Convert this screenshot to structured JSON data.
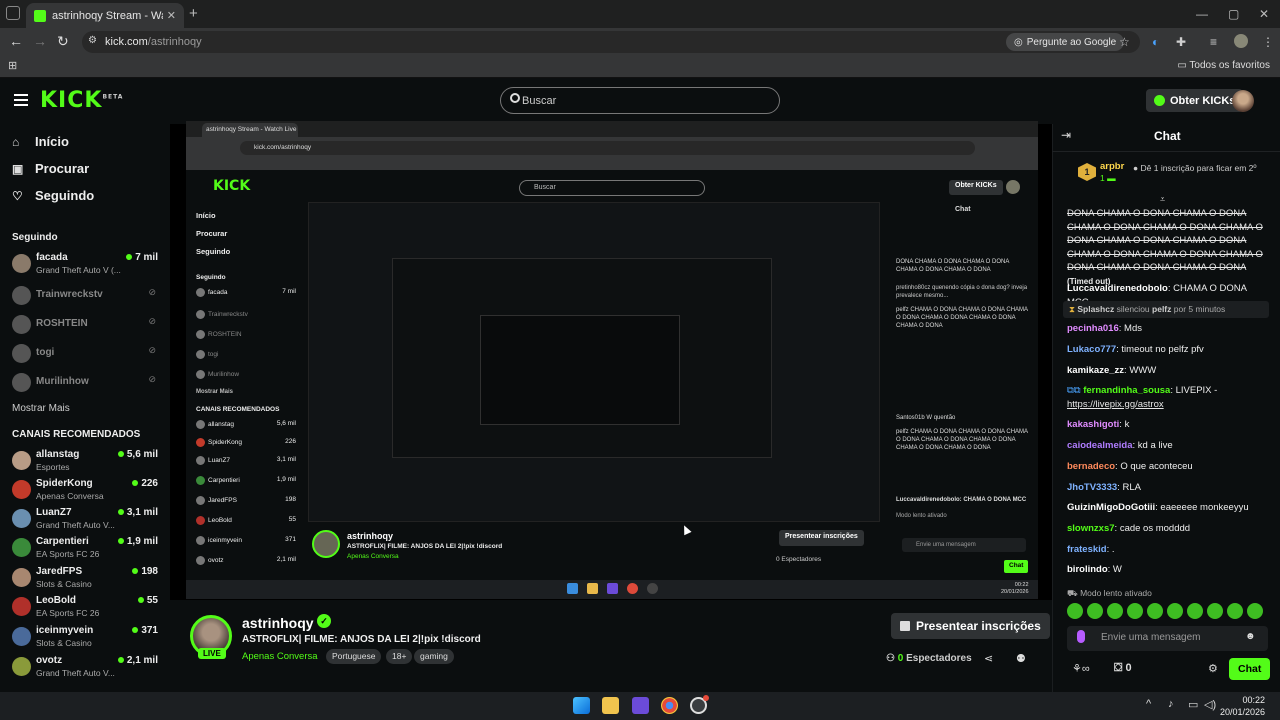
{
  "browser": {
    "tab_title": "astrinhoqy Stream - Watch Live",
    "tab_close": "✕",
    "new_tab": "+",
    "url_domain": "kick.com",
    "url_path": "/astrinhoqy",
    "ask_google": "Pergunte ao Google",
    "bookmarks_folder": "Todos os favoritos"
  },
  "header": {
    "logo": "KICK",
    "logo_sup": "BETA",
    "search_placeholder": "Buscar",
    "get_kicks": "Obter KICKs"
  },
  "sidebar": {
    "nav": [
      {
        "label": "Início",
        "icon": "home-icon"
      },
      {
        "label": "Procurar",
        "icon": "browse-icon"
      },
      {
        "label": "Seguindo",
        "icon": "heart-icon"
      }
    ],
    "following_title": "Seguindo",
    "following": [
      {
        "name": "facada",
        "game": "Grand Theft Auto V (...",
        "viewers": "7 mil",
        "online": true
      },
      {
        "name": "Trainwreckstv",
        "online": false
      },
      {
        "name": "ROSHTEIN",
        "online": false
      },
      {
        "name": "togi",
        "online": false
      },
      {
        "name": "Murilinhow",
        "online": false
      }
    ],
    "show_more": "Mostrar Mais",
    "recommended_title": "CANAIS RECOMENDADOS",
    "recommended": [
      {
        "name": "allanstag",
        "game": "Esportes",
        "viewers": "5,6 mil"
      },
      {
        "name": "SpiderKong",
        "game": "Apenas Conversa",
        "viewers": "226"
      },
      {
        "name": "LuanZ7",
        "game": "Grand Theft Auto V...",
        "viewers": "3,1 mil"
      },
      {
        "name": "Carpentieri",
        "game": "EA Sports FC 26",
        "viewers": "1,9 mil"
      },
      {
        "name": "JaredFPS",
        "game": "Slots & Casino",
        "viewers": "198"
      },
      {
        "name": "LeoBold",
        "game": "EA Sports FC 26",
        "viewers": "55"
      },
      {
        "name": "iceinmyvein",
        "game": "Slots & Casino",
        "viewers": "371"
      },
      {
        "name": "ovotz",
        "game": "Grand Theft Auto V...",
        "viewers": "2,1 mil"
      }
    ]
  },
  "stream": {
    "name": "astrinhoqy",
    "live": "LIVE",
    "title": "ASTROFLIX| FILME: ANJOS DA LEI 2|!pix !discord",
    "category": "Apenas Conversa",
    "tags": [
      "Portuguese",
      "18+",
      "gaming"
    ],
    "subscribe": "Presentear inscrições",
    "viewers_count": "0",
    "viewers_label": "Espectadores"
  },
  "chat": {
    "title": "Chat",
    "pinned": {
      "rank": "1",
      "user": "arpbr",
      "subs": "1",
      "text": "Dê 1 inscrição para ficar em 2º"
    },
    "strike_text": "DONA CHAMA O DONA CHAMA O DONA CHAMA O DONA CHAMA O DONA CHAMA O DONA CHAMA O DONA CHAMA O DONA CHAMA O DONA CHAMA O DONA CHAMA O DONA CHAMA O DONA CHAMA O DONA",
    "timed_out": "(Timed out)",
    "silenced": {
      "mod": "Splashcz",
      "text1": "silenciou",
      "user": "pelfz",
      "text2": "por 5 minutos"
    },
    "messages": [
      {
        "user": "Luccavaldirenedobolo",
        "color": "#ffffff",
        "text": "CHAMA O DONA MCC"
      },
      {
        "user": "pecinha016",
        "color": "#e08cff",
        "text": "Mds"
      },
      {
        "user": "Lukaco777",
        "color": "#7fb2ff",
        "text": "timeout no pelfz pfv"
      },
      {
        "user": "kamikaze_zz",
        "color": "#ffffff",
        "text": "WWW"
      },
      {
        "user": "fernandinha_sousa",
        "color": "#53fc18",
        "text": "LIVEPIX -",
        "link": "https://livepix.gg/astrox"
      },
      {
        "user": "kakashigoti",
        "color": "#e08cff",
        "text": "k"
      },
      {
        "user": "caiodealmeida",
        "color": "#b07dff",
        "text": "kd a live"
      },
      {
        "user": "bernadeco",
        "color": "#ff8a5c",
        "text": "O que aconteceu"
      },
      {
        "user": "JhoTV3333",
        "color": "#7fb2ff",
        "text": "RLA"
      },
      {
        "user": "GuizinMigoDoGotiii",
        "color": "#ffffff",
        "text": "eaeeeee monkeeyyu"
      },
      {
        "user": "slownzxs7",
        "color": "#53fc18",
        "text": "cade os modddd"
      },
      {
        "user": "frateskid",
        "color": "#7fb2ff",
        "text": "."
      },
      {
        "user": "birolindo",
        "color": "#ffffff",
        "text": "W"
      }
    ],
    "slow_mode": "Modo lento ativado",
    "input_placeholder": "Envie uma mensagem",
    "count": "0",
    "send": "Chat"
  },
  "inner_capture": {
    "tab_title": "astrinhoqy Stream - Watch Live",
    "url": "kick.com/astrinhoqy",
    "search": "Buscar",
    "get_kicks": "Obter KICKs",
    "nav": [
      "Início",
      "Procurar",
      "Seguindo"
    ],
    "following_title": "Seguindo",
    "show_more": "Mostrar Mais",
    "recommended_title": "CANAIS RECOMENDADOS",
    "channels": [
      {
        "name": "facada",
        "viewers": "7 mil"
      },
      {
        "name": "Trainwreckstv",
        "viewers": ""
      },
      {
        "name": "ROSHTEIN",
        "viewers": ""
      },
      {
        "name": "togi",
        "viewers": ""
      },
      {
        "name": "Murilinhow",
        "viewers": ""
      }
    ],
    "recommended": [
      {
        "name": "allanstag",
        "viewers": "5,6 mil"
      },
      {
        "name": "SpiderKong",
        "viewers": "226"
      },
      {
        "name": "LuanZ7",
        "viewers": "3,1 mil"
      },
      {
        "name": "Carpentieri",
        "viewers": "1,9 mil"
      },
      {
        "name": "JaredFPS",
        "viewers": "198"
      },
      {
        "name": "LeoBold",
        "viewers": "55"
      },
      {
        "name": "iceinmyvein",
        "viewers": "371"
      },
      {
        "name": "ovotz",
        "viewers": "2,1 mil"
      }
    ],
    "chat_title": "Chat",
    "chat_lines": [
      "DONA CHAMA O DONA CHAMA O DONA CHAMA O DONA CHAMA O DONA",
      "pretinho80cz quenendo cópia o dona dog? inveja prevalece mesmo...",
      "pelfz CHAMA O DONA CHAMA O DONA CHAMA O DONA CHAMA O DONA CHAMA O DONA CHAMA O DONA",
      "Santos01b W quentão",
      "pelfz CHAMA O DONA CHAMA O DONA CHAMA O DONA CHAMA O DONA CHAMA O DONA CHAMA O DONA CHAMA O DONA",
      "Luccavaldirenedobolo: CHAMA O DONA MCC"
    ],
    "slow_mode": "Modo lento ativado",
    "input": "Envie uma mensagem",
    "stream_name": "astrinhoqy",
    "stream_title": "ASTROFLIX| FILME: ANJOS DA LEI 2|!pix !discord",
    "category": "Apenas Conversa",
    "subscribe": "Presentear inscrições",
    "viewers": "0 Espectadores",
    "time": "00:22",
    "date": "20/01/2026"
  },
  "taskbar": {
    "time": "00:22",
    "date": "20/01/2026"
  }
}
